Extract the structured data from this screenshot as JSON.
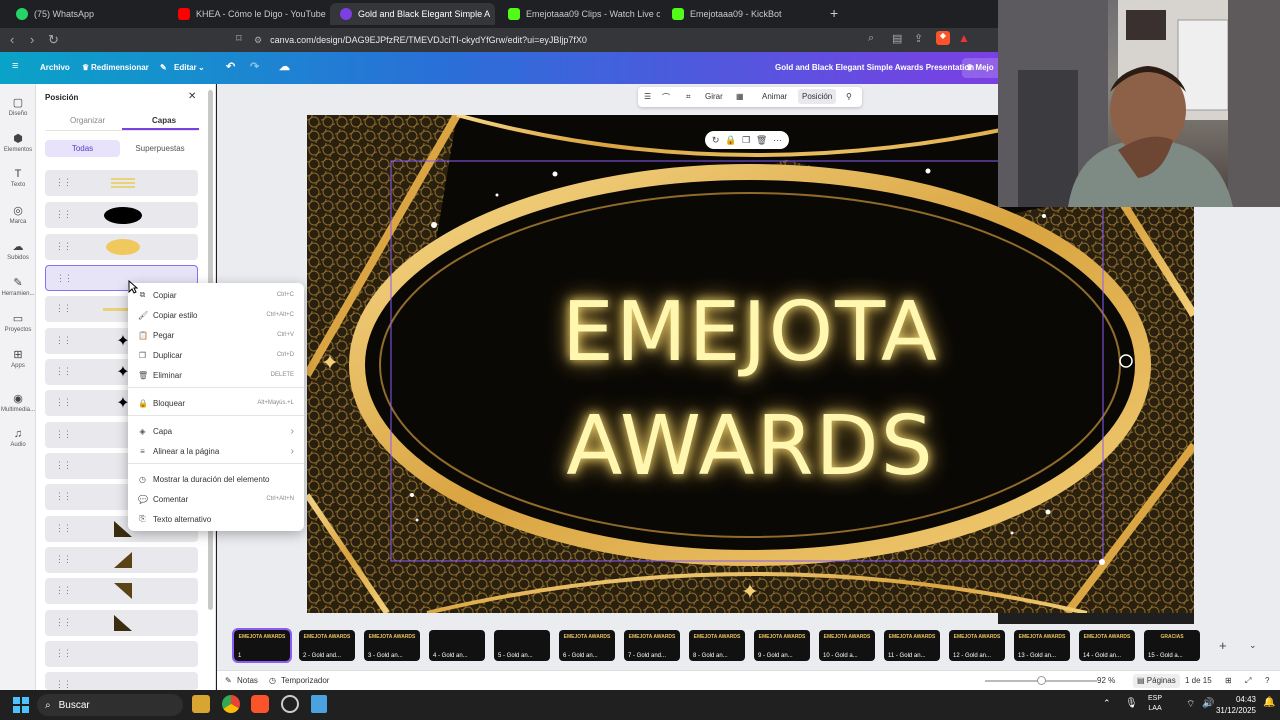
{
  "browser": {
    "tabs": [
      {
        "label": "(75) WhatsApp"
      },
      {
        "label": "KHEA - Cómo le Digo - YouTube"
      },
      {
        "label": "Gold and Black Elegant Simple A"
      },
      {
        "label": "Emejotaaa09 Clips - Watch Live o"
      },
      {
        "label": "Emejotaaa09 - KickBot"
      }
    ],
    "url": "canva.com/design/DAG9EJPfzRE/TMEVDJciTI-ckydYfGrw/edit?ui=eyJBljp7fX0",
    "new_tab": "+"
  },
  "header": {
    "menu_icon": "≡",
    "archivo": "Archivo",
    "redimensionar": "Redimensionar",
    "editar": "Editar",
    "title": "Gold and Black Elegant Simple Awards Presentation",
    "mejora": "Mejo"
  },
  "rail": [
    {
      "label": "Diseño",
      "icon": "▢"
    },
    {
      "label": "Elementos",
      "icon": "⬢"
    },
    {
      "label": "Texto",
      "icon": "T"
    },
    {
      "label": "Marca",
      "icon": "◎"
    },
    {
      "label": "Subidos",
      "icon": "☁"
    },
    {
      "label": "Herramien...",
      "icon": "✎"
    },
    {
      "label": "Proyectos",
      "icon": "▭"
    },
    {
      "label": "Apps",
      "icon": "⊞"
    },
    {
      "label": "Multimedia...",
      "icon": "◉"
    },
    {
      "label": "Audio",
      "icon": "♫"
    }
  ],
  "panel": {
    "title": "Posición",
    "tab_organize": "Organizar",
    "tab_layers": "Capas",
    "filter_all": "Todas",
    "filter_overlap": "Superpuestas"
  },
  "context_toolbar": {
    "girar": "Girar",
    "animar": "Animar",
    "posicion": "Posición"
  },
  "context_menu": {
    "items": [
      {
        "label": "Copiar",
        "shortcut": "Ctrl+C",
        "icon": "⧉"
      },
      {
        "label": "Copiar estilo",
        "shortcut": "Ctrl+Alt+C",
        "icon": "🖌"
      },
      {
        "label": "Pegar",
        "shortcut": "Ctrl+V",
        "icon": "📋"
      },
      {
        "label": "Duplicar",
        "shortcut": "Ctrl+D",
        "icon": "❐"
      },
      {
        "label": "Eliminar",
        "shortcut": "DELETE",
        "icon": "🗑"
      },
      {
        "label": "Bloquear",
        "shortcut": "Alt+Mayús.+L",
        "icon": "🔒"
      },
      {
        "label": "Capa",
        "shortcut": "›",
        "icon": "◈"
      },
      {
        "label": "Alinear a la página",
        "shortcut": "›",
        "icon": "≡"
      },
      {
        "label": "Mostrar la duración del elemento",
        "shortcut": "",
        "icon": "◷"
      },
      {
        "label": "Comentar",
        "shortcut": "Ctrl+Alt+N",
        "icon": "💬"
      },
      {
        "label": "Texto alternativo",
        "shortcut": "",
        "icon": "⎘"
      }
    ]
  },
  "slide": {
    "line1": "EMEJOTA",
    "line2": "AWARDS"
  },
  "thumbnails": [
    {
      "label": "1",
      "title": "EMEJOTA AWARDS"
    },
    {
      "label": "2 - Gold and...",
      "title": "EMEJOTA AWARDS"
    },
    {
      "label": "3 - Gold an...",
      "title": "EMEJOTA AWARDS"
    },
    {
      "label": "4 - Gold an...",
      "title": ""
    },
    {
      "label": "5 - Gold an...",
      "title": ""
    },
    {
      "label": "6 - Gold an...",
      "title": "EMEJOTA AWARDS"
    },
    {
      "label": "7 - Gold and...",
      "title": "EMEJOTA AWARDS"
    },
    {
      "label": "8 - Gold an...",
      "title": "EMEJOTA AWARDS"
    },
    {
      "label": "9 - Gold an...",
      "title": "EMEJOTA AWARDS"
    },
    {
      "label": "10 - Gold a...",
      "title": "EMEJOTA AWARDS"
    },
    {
      "label": "11 - Gold an...",
      "title": "EMEJOTA AWARDS"
    },
    {
      "label": "12 - Gold an...",
      "title": "EMEJOTA AWARDS"
    },
    {
      "label": "13 - Gold an...",
      "title": "EMEJOTA AWARDS"
    },
    {
      "label": "14 - Gold an...",
      "title": "EMEJOTA AWARDS"
    },
    {
      "label": "15 - Gold a...",
      "title": "GRACIAS"
    }
  ],
  "footer": {
    "notas": "Notas",
    "temporizador": "Temporizador",
    "zoom": "92 %",
    "paginas": "Páginas",
    "page_count": "1 de 15"
  },
  "taskbar": {
    "search": "Buscar",
    "lang1": "ESP",
    "lang2": "LAA",
    "time": "04:43",
    "date": "31/12/2025"
  },
  "colors": {
    "gold": "#e7b652",
    "glow_text": "#fff7b0",
    "slide_bg": "#0a0805",
    "canva_header_start": "#0aa3c8",
    "canva_header_end": "#7b3fe4"
  }
}
